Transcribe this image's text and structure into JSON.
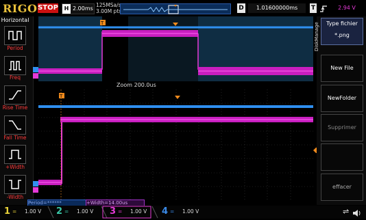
{
  "topbar": {
    "logo": "RIGOL",
    "run_state": "STOP",
    "h_label": "H",
    "timebase": "2.00ms",
    "sample_rate": "125MSa/s",
    "memory_depth": "3.00M pts",
    "d_label": "D",
    "delay": "1.01600000ms",
    "t_label": "T",
    "trigger_level": "2.94 V"
  },
  "left_menu": {
    "title": "Horizontal",
    "items": [
      {
        "label": "Period",
        "icon": "period-icon"
      },
      {
        "label": "Freq",
        "icon": "freq-icon"
      },
      {
        "label": "Rise Time",
        "icon": "rise-time-icon"
      },
      {
        "label": "Fall Time",
        "icon": "fall-time-icon"
      },
      {
        "label": "+Width",
        "icon": "positive-width-icon"
      },
      {
        "label": "-Width",
        "icon": "negative-width-icon"
      }
    ]
  },
  "scope": {
    "zoom_label": "Zoom 200.0us",
    "period_readout": "Period=******",
    "width_readout": "+Width=14.00us"
  },
  "right_menu": {
    "side_label": "DiskManage",
    "type_title": "Type fichier",
    "type_value": "*.png",
    "new_file": "New File",
    "new_folder": "NewFolder",
    "delete": "Supprimer",
    "clear": "effacer"
  },
  "channels": [
    {
      "num": "1",
      "scale": "1.00 V",
      "color": "#e8d23a"
    },
    {
      "num": "2",
      "scale": "1.00 V",
      "color": "#3ac8a8"
    },
    {
      "num": "3",
      "scale": "1.00 V",
      "color": "#e63ad8"
    },
    {
      "num": "4",
      "scale": "1.00 V",
      "color": "#3a8ae8"
    }
  ],
  "colors": {
    "ch_blue": "#2f8ff0",
    "ch_magenta": "#e63ad8",
    "trigger_orange": "#f08a1c",
    "stop_red": "#cc1010"
  }
}
